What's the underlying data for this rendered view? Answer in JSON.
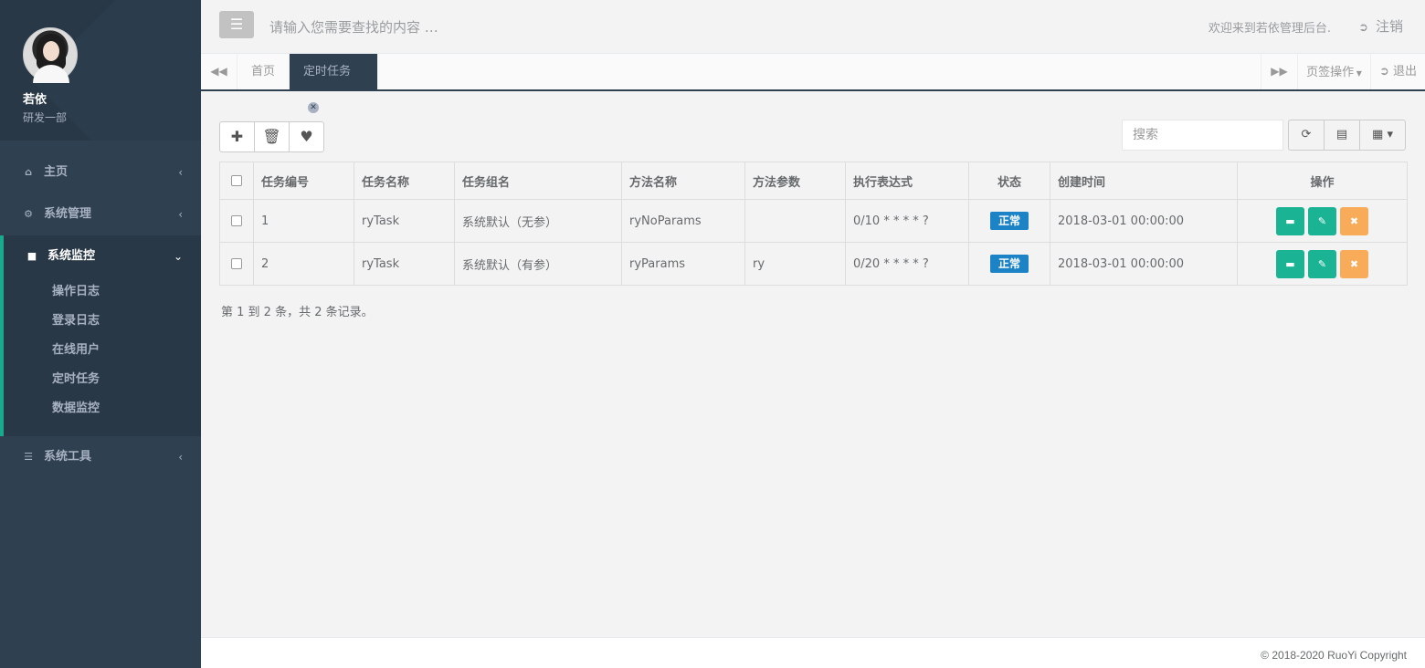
{
  "profile": {
    "name": "若依",
    "dept": "研发一部"
  },
  "nav": {
    "home": "主页",
    "system": "系统管理",
    "monitor": "系统监控",
    "monitor_items": [
      "操作日志",
      "登录日志",
      "在线用户",
      "定时任务",
      "数据监控"
    ],
    "tools": "系统工具"
  },
  "topbar": {
    "search_placeholder": "请输入您需要查找的内容 …",
    "welcome": "欢迎来到若依管理后台.",
    "logout": "注销"
  },
  "tabs": {
    "home": "首页",
    "active": "定时任务",
    "ops": "页签操作",
    "exit": "退出"
  },
  "search": {
    "placeholder": "搜索"
  },
  "table": {
    "headers": [
      "任务编号",
      "任务名称",
      "任务组名",
      "方法名称",
      "方法参数",
      "执行表达式",
      "状态",
      "创建时间",
      "操作"
    ],
    "rows": [
      {
        "id": "1",
        "name": "ryTask",
        "group": "系统默认（无参）",
        "method": "ryNoParams",
        "params": "",
        "cron": "0/10 * * * * ?",
        "status": "正常",
        "created": "2018-03-01 00:00:00"
      },
      {
        "id": "2",
        "name": "ryTask",
        "group": "系统默认（有参）",
        "method": "ryParams",
        "params": "ry",
        "cron": "0/20 * * * * ?",
        "status": "正常",
        "created": "2018-03-01 00:00:00"
      }
    ]
  },
  "summary": "第 1 到 2 条，共 2 条记录。",
  "footer": "© 2018-2020 RuoYi Copyright",
  "colors": {
    "sidebar": "#2f4050",
    "accent": "#1ab394",
    "status_badge": "#1c84c6",
    "warning": "#f8ac59"
  }
}
